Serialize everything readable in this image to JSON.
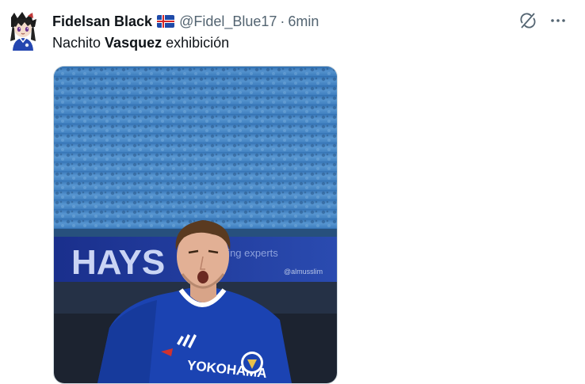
{
  "tweet": {
    "author": {
      "display_name": "Fidelsan Black",
      "handle": "@Fidel_Blue17",
      "flag_icon": "iceland-flag-icon",
      "avatar_icon": "anime-avatar-icon"
    },
    "separator": "·",
    "time": "6min",
    "text": {
      "part1": "Nachito ",
      "bold": "Vasquez",
      "part2": " exhibición"
    },
    "actions": {
      "grok_icon": "grok-icon",
      "more_icon": "more-options-icon"
    },
    "media": {
      "watermark": "@almusslim",
      "banner_text": "HAYS",
      "banner_subtext": "Recruiting experts",
      "sponsor_text": "YOKOHAMA"
    }
  },
  "colors": {
    "primary_text": "#0f1419",
    "secondary_text": "#536471",
    "jersey_blue": "#1a3fa8",
    "banner_blue": "#1e3a9a",
    "stands_blue": "#4f8dc9"
  }
}
